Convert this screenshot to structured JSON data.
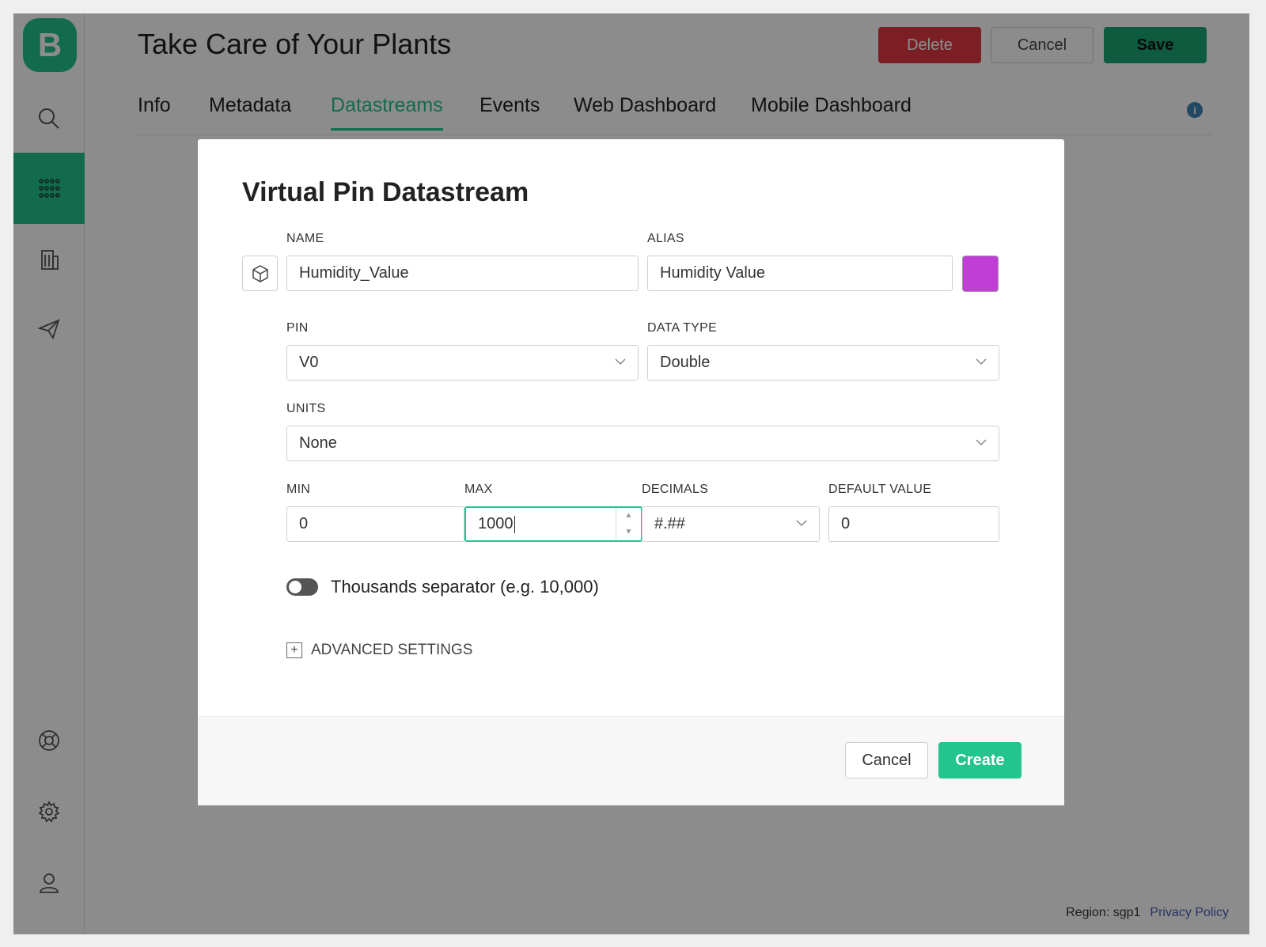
{
  "app": {
    "logo_letter": "B",
    "title": "Take Care of Your Plants",
    "header_buttons": {
      "delete": "Delete",
      "cancel": "Cancel",
      "save": "Save"
    },
    "tabs": [
      "Info",
      "Metadata",
      "Datastreams",
      "Events",
      "Web Dashboard",
      "Mobile Dashboard"
    ],
    "active_tab": "Datastreams",
    "info_icon": "i",
    "sidebar_icons": [
      "search-icon",
      "grid-icon",
      "building-icon",
      "send-icon",
      "help-icon",
      "gear-icon",
      "user-icon"
    ],
    "footer": {
      "region": "Region: sgp1",
      "privacy": "Privacy Policy"
    }
  },
  "modal": {
    "title": "Virtual Pin Datastream",
    "name": {
      "label": "NAME",
      "value": "Humidity_Value"
    },
    "alias": {
      "label": "ALIAS",
      "value": "Humidity Value"
    },
    "color": "#c13ed6",
    "pin": {
      "label": "PIN",
      "value": "V0"
    },
    "data_type": {
      "label": "DATA TYPE",
      "value": "Double"
    },
    "units": {
      "label": "UNITS",
      "value": "None"
    },
    "min": {
      "label": "MIN",
      "value": "0"
    },
    "max": {
      "label": "MAX",
      "value": "1000"
    },
    "decimals": {
      "label": "DECIMALS",
      "value": "#.##"
    },
    "default_value": {
      "label": "DEFAULT VALUE",
      "value": "0"
    },
    "thousands_separator": {
      "label": "Thousands separator (e.g. 10,000)",
      "enabled": false
    },
    "advanced": {
      "label": "ADVANCED SETTINGS",
      "icon": "+"
    },
    "buttons": {
      "cancel": "Cancel",
      "create": "Create"
    }
  },
  "colors": {
    "accent": "#23c48e",
    "danger": "#e03a44",
    "save": "#1aa774"
  }
}
